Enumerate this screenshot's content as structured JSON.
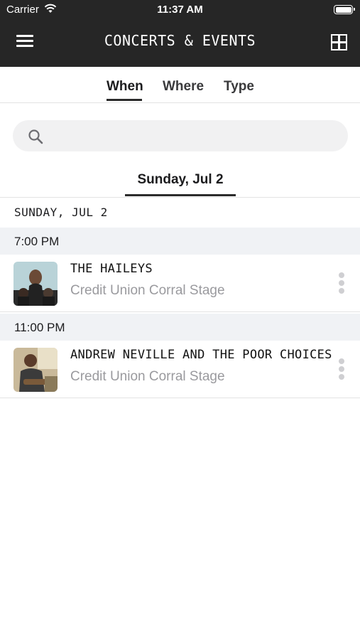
{
  "status_bar": {
    "carrier": "Carrier",
    "time": "11:37 AM"
  },
  "header": {
    "title": "CONCERTS & EVENTS",
    "icons": {
      "menu": "hamburger-icon",
      "view": "grid-view-icon"
    }
  },
  "tabs": [
    {
      "label": "When",
      "active": true
    },
    {
      "label": "Where",
      "active": false
    },
    {
      "label": "Type",
      "active": false
    }
  ],
  "search": {
    "placeholder": "",
    "value": ""
  },
  "date_tab": {
    "label": "Sunday, Jul 2"
  },
  "day_section": {
    "label": "SUNDAY, JUL 2"
  },
  "events": [
    {
      "time": "7:00 PM",
      "name": "THE HAILEYS",
      "venue": "Credit Union Corral Stage"
    },
    {
      "time": "11:00 PM",
      "name": "ANDREW NEVILLE AND THE POOR CHOICES",
      "venue": "Credit Union Corral Stage"
    }
  ],
  "colors": {
    "header_bg": "#262626",
    "time_bar_bg": "#f0f2f5",
    "venue_text": "#9a9a9e"
  }
}
